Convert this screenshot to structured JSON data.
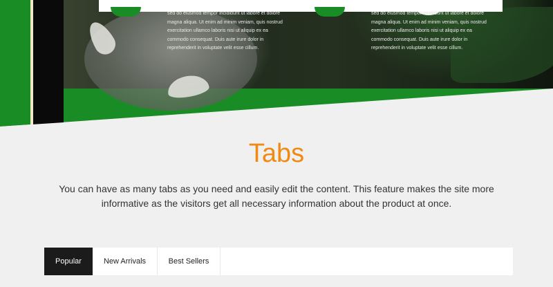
{
  "hero": {
    "columns": [
      {
        "lines": [
          "sed do eiusmod tempor incididunt ut labore et dolore",
          "magna aliqua. Ut enim ad minim veniam, quis nostrud",
          "exercitation ullamco laboris nisi ut aliquip ex ea",
          "commodo consequat. Duis aute irure dolor in",
          "reprehenderit in voluptate velit esse cillum."
        ]
      },
      {
        "lines": [
          "sed do eiusmod tempor incididunt ut labore et dolore",
          "magna aliqua. Ut enim ad minim veniam, quis nostrud",
          "exercitation ullamco laboris nisi ut aliquip ex ea",
          "commodo consequat. Duis aute irure dolor in",
          "reprehenderit in voluptate velit esse cillum."
        ]
      }
    ]
  },
  "tabs_section": {
    "title": "Tabs",
    "description": "You can have as many tabs as you need and easily edit the content. This feature makes the site more informative as the visitors get all necessary information about the product at once.",
    "tabs": [
      {
        "label": "Popular",
        "active": true
      },
      {
        "label": "New Arrivals",
        "active": false
      },
      {
        "label": "Best Sellers",
        "active": false
      }
    ]
  },
  "colors": {
    "accent_orange": "#f08a13",
    "brand_green": "#1a8c26",
    "active_tab": "#1b1b1b",
    "page_bg": "#f0f0f0"
  }
}
